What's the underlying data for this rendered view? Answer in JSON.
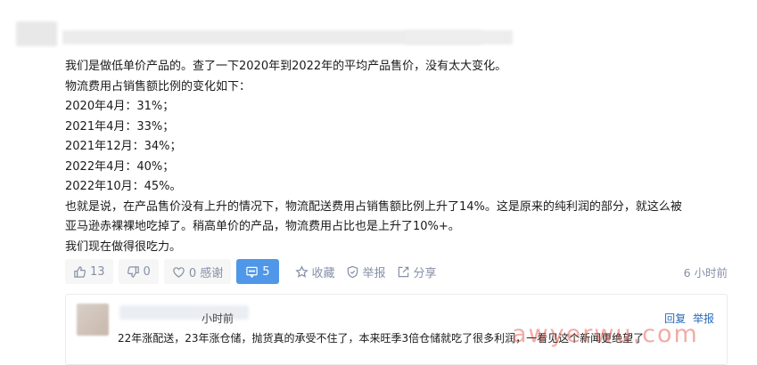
{
  "post": {
    "lines": [
      "我们是做低单价产品的。查了一下2020年到2022年的平均产品售价，没有太大变化。",
      "物流费用占销售额比例的变化如下：",
      "2020年4月：31%；",
      "2021年4月：33%；",
      "2021年12月：34%；",
      "2022年4月：40%；",
      "2022年10月：45%。",
      "也就是说，在产品售价没有上升的情况下，物流配送费用占销售额比例上升了14%。这是原来的纯利润的部分，就这么被",
      "亚马逊赤裸裸地吃掉了。稍高单价的产品，物流费用占比也是上升了10%+。",
      "我们现在做得很吃力。"
    ]
  },
  "actions": {
    "upvote_count": "13",
    "downvote_count": "0",
    "thanks_label": "0 感谢",
    "comment_count": "5",
    "favorite_label": "收藏",
    "report_label": "举报",
    "share_label": "分享",
    "time": "6 小时前",
    "accent": "#4f97e8"
  },
  "reply": {
    "time": "小时前",
    "reply_label": "回复",
    "report_label": "举报",
    "text": "22年涨配送，23年涨仓储，抛货真的承受不住了，本来旺季3倍仓储就吃了很多利润，一看见这个新闻更绝望了"
  },
  "watermark": "awyerwu.com"
}
